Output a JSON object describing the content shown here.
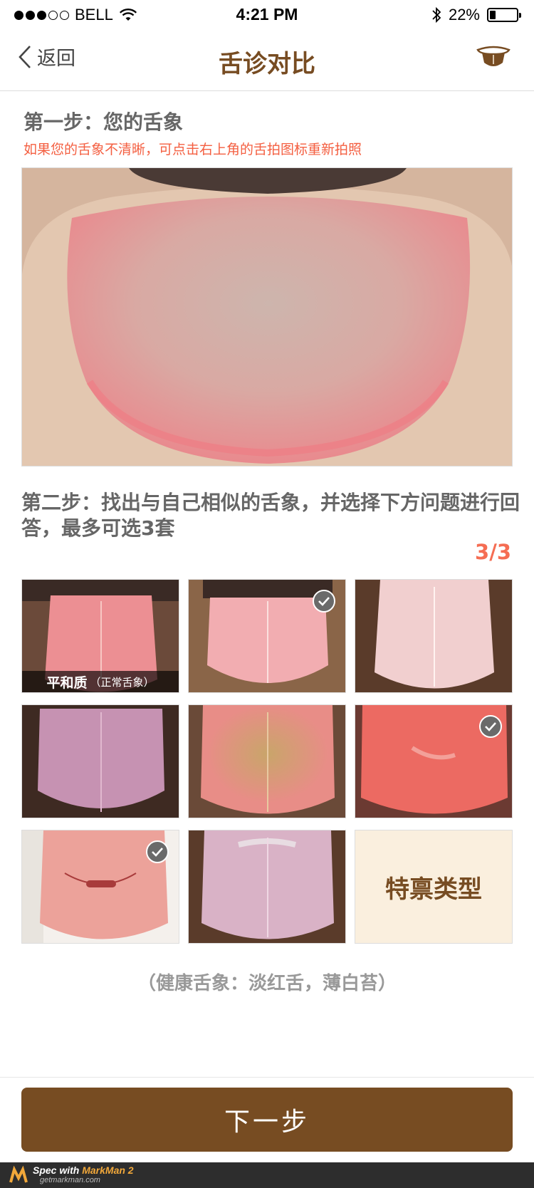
{
  "status_bar": {
    "carrier": "BELL",
    "time": "4:21 PM",
    "battery": "22%",
    "battery_level": 0.22,
    "signal_filled": 3,
    "signal_total": 5
  },
  "nav": {
    "back_label": "返回",
    "title": "舌诊对比"
  },
  "step1": {
    "title": "第一步：您的舌象",
    "hint": "如果您的舌象不清晰，可点击右上角的舌拍图标重新拍照"
  },
  "step2": {
    "title": "第二步：找出与自己相似的舌象，并选择下方问题进行回答，最多可选3套",
    "counter": "3/3"
  },
  "tiles": [
    {
      "overlay_main": "平和质",
      "overlay_sub": "（正常舌象）",
      "selected": false
    },
    {
      "selected": true
    },
    {
      "selected": false
    },
    {
      "selected": false
    },
    {
      "selected": false
    },
    {
      "selected": true
    },
    {
      "selected": true
    },
    {
      "selected": false
    },
    {
      "special_label": "特禀类型"
    }
  ],
  "health_text": "（健康舌象：淡红舌，薄白苔）",
  "next_button": "下一步",
  "watermark": {
    "line1_prefix": "Spec with ",
    "line1_brand": "MarkMan 2",
    "line2": "getmarkman.com"
  },
  "colors": {
    "brand": "#774c22",
    "accent": "#f56d53",
    "hint": "#f45f41",
    "text": "#666666",
    "muted": "#999999",
    "special_bg": "#faefde",
    "border": "#dddddd"
  },
  "icons": [
    "signal-dots-icon",
    "wifi-icon",
    "bluetooth-icon",
    "battery-icon",
    "back-chevron-icon",
    "tongue-camera-icon",
    "check-icon"
  ]
}
